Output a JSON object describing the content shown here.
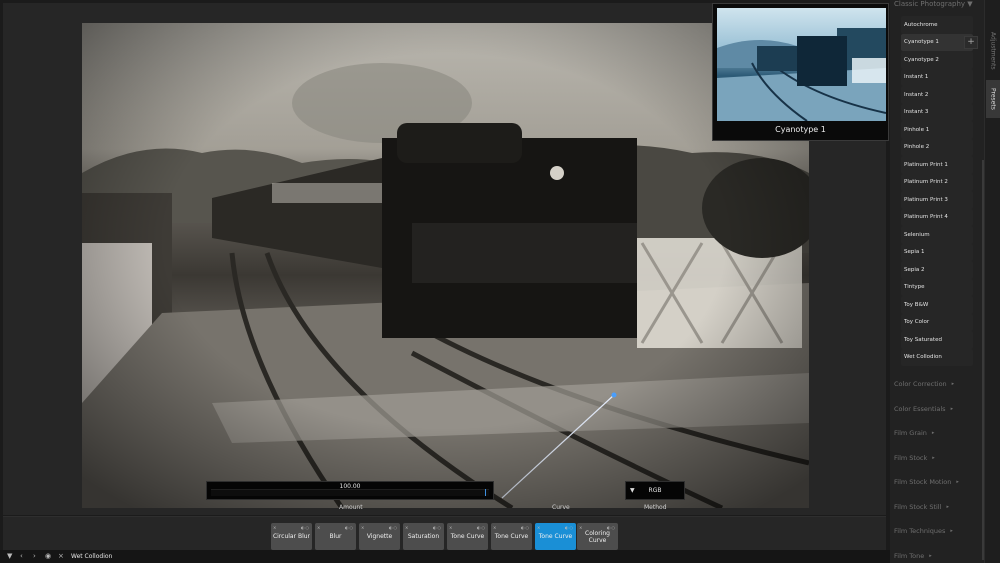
{
  "viewer": {
    "amount_label": "Amount",
    "amount_value": "100.00",
    "amount_fraction": 0.98,
    "curve_label": "Curve",
    "method_label": "Method",
    "method_value": "RGB"
  },
  "preview": {
    "title": "Cyanotype 1"
  },
  "presets_panel": {
    "heading": "Classic Photography",
    "items": [
      "Autochrome",
      "Cyanotype 1",
      "Cyanotype 2",
      "Instant 1",
      "Instant 2",
      "Instant 3",
      "Pinhole 1",
      "Pinhole 2",
      "Platinum Print 1",
      "Platinum Print 2",
      "Platinum Print 3",
      "Platinum Print 4",
      "Selenium",
      "Sepia 1",
      "Sepia 2",
      "Tintype",
      "Toy B&W",
      "Toy Color",
      "Toy Saturated",
      "Wet Collodion"
    ],
    "hovered_item": "Cyanotype 1",
    "categories": [
      "Color Correction",
      "Color Essentials",
      "Film Grain",
      "Film Stock",
      "Film Stock Motion",
      "Film Stock Still",
      "Film Techniques",
      "Film Tone"
    ],
    "add_label": "+"
  },
  "tabs": {
    "adjustments": "Adjustments",
    "presets": "Presets"
  },
  "filter_chain": [
    {
      "label": "Circular Blur",
      "active": false
    },
    {
      "label": "Blur",
      "active": false
    },
    {
      "label": "Vignette",
      "active": false
    },
    {
      "label": "Saturation",
      "active": false
    },
    {
      "label": "Tone Curve",
      "active": false
    },
    {
      "label": "Tone Curve",
      "active": false
    },
    {
      "label": "Tone Curve",
      "active": true
    },
    {
      "label": "Coloring Curve",
      "active": false
    }
  ],
  "status": {
    "current_preset": "Wet Collodion"
  },
  "icons": {
    "caret": "chevron-down-icon",
    "nav_prev": "arrow-left-icon",
    "nav_next": "arrow-right-icon",
    "close": "close-icon"
  },
  "colors": {
    "accent": "#1a8fd6",
    "panel_bg": "#222222"
  }
}
